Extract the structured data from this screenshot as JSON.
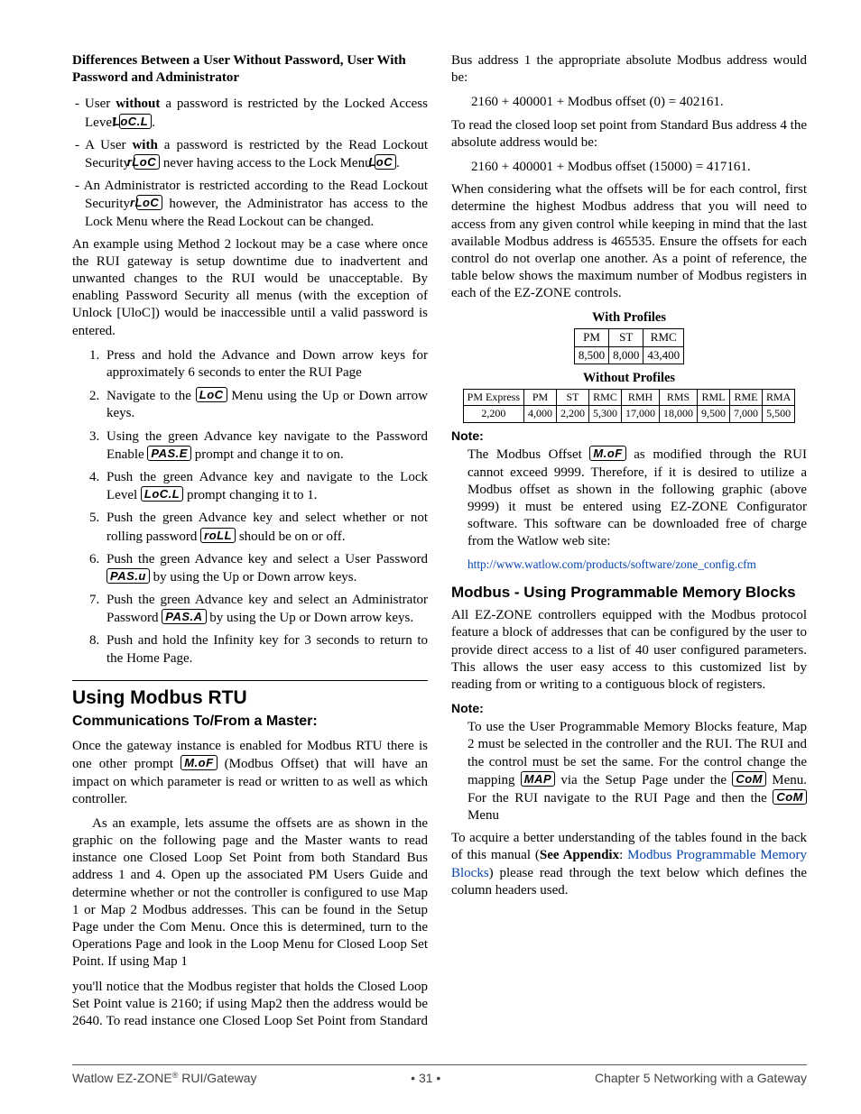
{
  "left": {
    "heading": "Differences Between a User Without Password, User With Password and Administrator",
    "bullet1a": "- User ",
    "bullet1b": "without",
    "bullet1c": " a password is restricted by the Locked Access Level ",
    "seg_LoCL": "LoC.L",
    "bullet1d": ".",
    "bullet2a": "- A User ",
    "bullet2b": "with",
    "bullet2c": " a password is restricted by the Read Lockout Security ",
    "seg_rLoC": "rLoC",
    "bullet2d": " never having access to the Lock Menu ",
    "seg_LoC": " LoC",
    "bullet2e": ".",
    "bullet3a": "- An Administrator is restricted according to the Read Lockout Security ",
    "bullet3b": " however, the Administrator has access to the Lock Menu where the Read Lockout can be changed.",
    "para1": "An example using Method 2 lockout may be a case where once the RUI gateway is setup downtime due to inadvertent and unwanted changes to the RUI would be unacceptable. By enabling Password Security all menus (with the exception of Unlock [UloC]) would be inaccessible until a valid password is entered.",
    "steps": [
      "Press and hold the Advance and Down arrow keys for approximately 6 seconds to enter the RUI Page",
      "Navigate to the [SEG:LoC] Menu using the Up or Down arrow keys.",
      "Using the green Advance key navigate to the Password Enable [SEG:PAS.E] prompt and change it to on.",
      "Push the green Advance key and navigate to the Lock Level [SEG:LoC.L] prompt changing it to 1.",
      "Push the green Advance key and select whether or not rolling password [SEG:roLL] should be on or off.",
      "Push the green Advance key and select a User Password [SEG:PAS.u] by using the Up or Down arrow keys.",
      "Push the green Advance key and select an Administrator Password [SEG:PAS.A] by using the Up or Down arrow keys.",
      "Push and hold the Infinity key for 3 seconds to return to the Home Page."
    ],
    "h2": "Using Modbus RTU",
    "h3": "Communications To/From a Master:",
    "rtu1a": "Once the gateway instance is enabled for Modbus RTU there is one other prompt ",
    "seg_MoF": "M.oF",
    "rtu1b": " (Modbus Offset) that will have an impact on which parameter is read or written to as well as which controller.",
    "rtu2": "As an example, lets assume the offsets are as shown in the graphic on the following page and the Master wants to read instance one Closed Loop Set Point from both Standard Bus address 1 and 4. Open up the associated PM Users Guide and determine whether or not the controller is configured to use Map 1 or Map 2 Modbus addresses. This can be found in the Setup Page under the Com Menu. Once this is determined, turn to the Operations Page and look in the Loop Menu for Closed Loop Set Point. If using Map 1"
  },
  "right": {
    "cont": "you'll notice that the Modbus register that holds the Closed Loop Set Point value is 2160; if using Map2 then the address would be 2640. To read instance one Closed Loop Set Point from Standard Bus address 1 the appropriate absolute Modbus address would be:",
    "formula1": "2160 + 400001 + Modbus offset (0) = 402161.",
    "p2": "To read the closed loop set point from Standard Bus address 4 the absolute address would be:",
    "formula2": "2160 + 400001 + Modbus offset (15000) = 417161.",
    "p3": "When considering what the offsets will be for each control, first determine the highest Modbus address that you will need to access from any given control while keeping in mind that the last available Modbus address is 465535. Ensure the offsets for each control do not overlap one another. As a point of reference, the table below shows the maximum number of Modbus registers in each of the EZ-ZONE controls.",
    "cap1": "With Profiles",
    "cap2": "Without Profiles",
    "note1a": "The Modbus Offset ",
    "note1b": " as modified through the RUI cannot exceed 9999. Therefore, if it is desired to utilize a Modbus offset as shown in the following graphic (above 9999) it must be entered using EZ-ZONE Configurator software. This software can be downloaded free of charge from the Watlow web site:",
    "link": "http://www.watlow.com/products/software/zone_config.cfm",
    "h3b": "Modbus - Using Programmable Memory Blocks",
    "pmb": "All EZ-ZONE controllers equipped with the Modbus protocol feature a block of addresses that can be configured by the user to provide direct access to a list of 40 user configured parameters. This allows the user easy access to this customized list by reading from or writing to a contiguous block of registers.",
    "note2a": "To use the User Programmable Memory Blocks feature, Map 2 must be selected in the controller and the RUI. The RUI and the control must be set the same. For the control change the mapping ",
    "seg_MAP": "MAP",
    "note2b": " via the Setup Page under the ",
    "seg_CoM": "CoM",
    "note2c": " Menu. For the RUI navigate to the RUI Page and then the ",
    "note2d": " Menu",
    "last1": "To acquire a better understanding of the tables found in the back of this manual (",
    "last_bold": "See Appendix",
    "last2": ": ",
    "last_link": "Modbus Programmable Memory Blocks",
    "last3": ") please read through the text below which defines the column headers used."
  },
  "chart_data": [
    {
      "type": "table",
      "title": "With Profiles",
      "columns": [
        "PM",
        "ST",
        "RMC"
      ],
      "rows": [
        [
          "8,500",
          "8,000",
          "43,400"
        ]
      ]
    },
    {
      "type": "table",
      "title": "Without Profiles",
      "columns": [
        "PM Express",
        "PM",
        "ST",
        "RMC",
        "RMH",
        "RMS",
        "RML",
        "RME",
        "RMA"
      ],
      "rows": [
        [
          "2,200",
          "4,000",
          "2,200",
          "5,300",
          "17,000",
          "18,000",
          "9,500",
          "7,000",
          "5,500"
        ]
      ]
    }
  ],
  "note_label": "Note:",
  "footer": {
    "left": "Watlow EZ-ZONE",
    "left2": " RUI/Gateway",
    "center": "•  31  •",
    "right": "Chapter 5 Networking with a Gateway"
  }
}
